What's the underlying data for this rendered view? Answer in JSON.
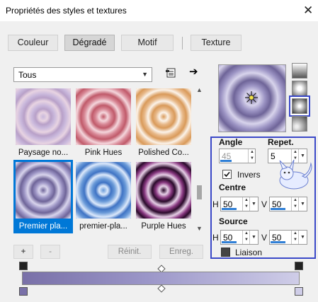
{
  "window": {
    "title": "Propriétés des styles et textures",
    "close_glyph": "✕"
  },
  "tabs": [
    {
      "label": "Couleur",
      "active": false
    },
    {
      "label": "Dégradé",
      "active": true
    },
    {
      "label": "Motif",
      "active": false
    },
    {
      "label": "Texture",
      "active": false
    }
  ],
  "category": {
    "selected": "Tous",
    "arrow_icon": "chevron-down-icon"
  },
  "toolbar_icons": {
    "folder": "folder-icon",
    "arrow": "➔"
  },
  "gradients": [
    {
      "label": "Paysage no...",
      "colors": [
        "#c9b8dc",
        "#e8d4e2",
        "#b8a0c8"
      ]
    },
    {
      "label": "Pink Hues",
      "colors": [
        "#c05a6a",
        "#f4d6dc",
        "#d88896"
      ]
    },
    {
      "label": "Polished Co...",
      "colors": [
        "#d99a5a",
        "#fbf3ea",
        "#e8b98a"
      ]
    },
    {
      "label": "Premier pla...",
      "colors": [
        "#6e6498",
        "#d8d4ec",
        "#9c94c4"
      ],
      "selected": true
    },
    {
      "label": "premier-pla...",
      "colors": [
        "#6a9ad8",
        "#dce9fb",
        "#3f73c4"
      ]
    },
    {
      "label": "Purple Hues",
      "colors": [
        "#2a0a2a",
        "#e6cfe6",
        "#8a3a82"
      ]
    }
  ],
  "bottom_buttons": {
    "add": "+",
    "remove": "-",
    "reset": "Réinit.",
    "save": "Enreg."
  },
  "style_buttons": [
    "linear",
    "rectangular",
    "sunburst",
    "radial"
  ],
  "settings": {
    "angle_label": "Angle",
    "angle_value": "45",
    "repeat_label": "Repet.",
    "repeat_value": "5",
    "invert_label": "Invers",
    "invert_checked": true,
    "center_label": "Centre",
    "center_h_label": "H",
    "center_h": "50",
    "center_v_label": "V",
    "center_v": "50",
    "source_label": "Source",
    "source_h_label": "H",
    "source_h": "50",
    "source_v_label": "V",
    "source_v": "50",
    "link_label": "Liaison",
    "link_checked": false
  },
  "colors": {
    "accent": "#0078d7",
    "highlight": "#3a48c8",
    "gradient_start": "#7970a8",
    "gradient_end": "#cfcde8"
  }
}
